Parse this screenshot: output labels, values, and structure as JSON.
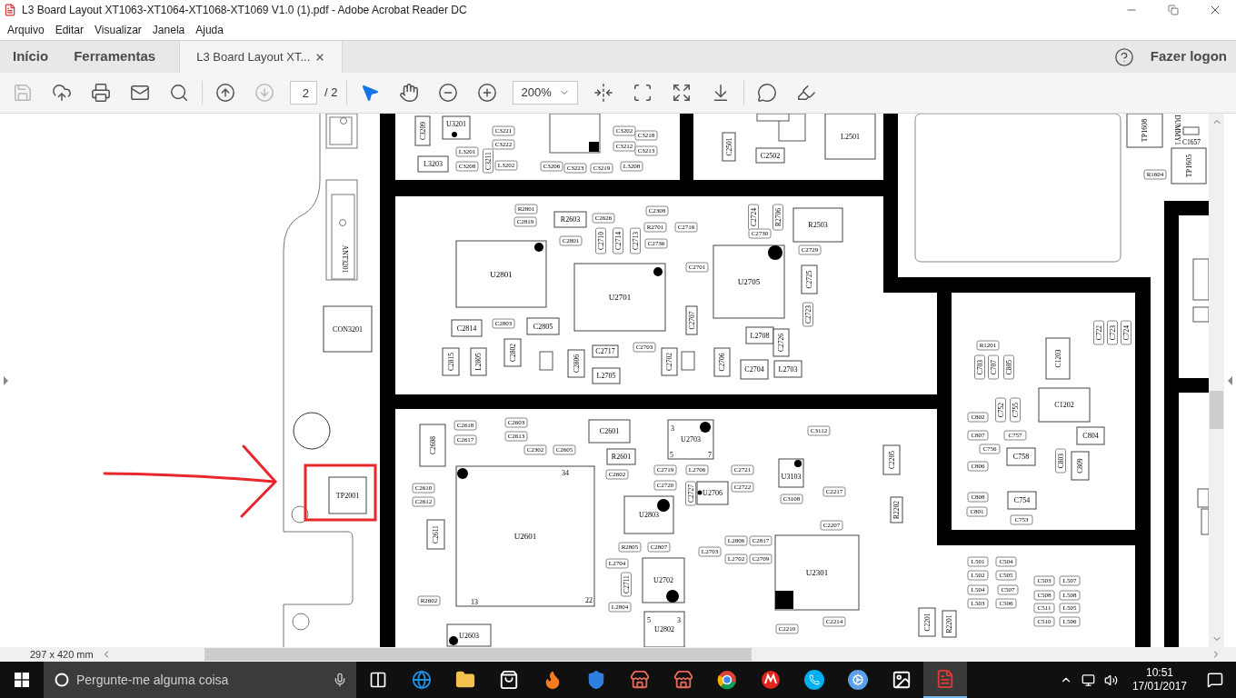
{
  "window": {
    "title": "L3 Board Layout XT1063-XT1064-XT1068-XT1069 V1.0 (1).pdf - Adobe Acrobat Reader DC"
  },
  "menu": [
    "Arquivo",
    "Editar",
    "Visualizar",
    "Janela",
    "Ajuda"
  ],
  "nav_tabs": [
    {
      "label": "Início",
      "selected": false
    },
    {
      "label": "Ferramentas",
      "selected": false
    }
  ],
  "doc_tab": {
    "label": "L3 Board Layout XT...",
    "selected": true
  },
  "account": {
    "label": "Fazer logon"
  },
  "toolbar": {
    "groups": [
      [
        {
          "kind": "save",
          "disabled": true
        },
        {
          "kind": "upload",
          "disabled": false
        },
        {
          "kind": "print",
          "disabled": false
        },
        {
          "kind": "mail",
          "disabled": false
        },
        {
          "kind": "search",
          "disabled": false
        }
      ],
      [
        {
          "kind": "prev",
          "disabled": false
        },
        {
          "kind": "next",
          "disabled": true
        },
        {
          "kind": "page_field",
          "value": "2",
          "total": "/ 2"
        }
      ],
      [
        {
          "kind": "select",
          "selected": true
        },
        {
          "kind": "hand",
          "selected": false
        },
        {
          "kind": "zoom_out",
          "disabled": false
        },
        {
          "kind": "zoom_in",
          "disabled": false
        },
        {
          "kind": "zoom_field",
          "value": "200%"
        },
        {
          "kind": "fit_width",
          "disabled": false
        },
        {
          "kind": "fit_page",
          "disabled": false
        },
        {
          "kind": "fullscreen",
          "disabled": false
        },
        {
          "kind": "read_mode",
          "disabled": false
        }
      ],
      [
        {
          "kind": "comment",
          "disabled": false
        },
        {
          "kind": "highlight",
          "disabled": false
        }
      ]
    ]
  },
  "document": {
    "parts": [
      {
        "label": "C3209",
        "kind": "vbox"
      },
      {
        "label": "U3201",
        "kind": "box"
      },
      {
        "label": "L3203",
        "kind": "box"
      },
      {
        "label": "L3201",
        "kind": "pill"
      },
      {
        "label": "C3221",
        "kind": "pill"
      },
      {
        "label": "C3222",
        "kind": "pill"
      },
      {
        "label": "C3208",
        "kind": "pill"
      },
      {
        "label": "C3211",
        "kind": "vpill"
      },
      {
        "label": "L3202",
        "kind": "pill"
      },
      {
        "label": "C3202",
        "kind": "pill"
      },
      {
        "label": "C3218",
        "kind": "pill"
      },
      {
        "label": "C3212",
        "kind": "pill"
      },
      {
        "label": "C3213",
        "kind": "pill"
      },
      {
        "label": "C3206",
        "kind": "pill"
      },
      {
        "label": "C3223",
        "kind": "pill"
      },
      {
        "label": "C3219",
        "kind": "pill"
      },
      {
        "label": "L3208",
        "kind": "pill"
      },
      {
        "label": "C2501",
        "kind": "vbox"
      },
      {
        "label": "C2502",
        "kind": "box"
      },
      {
        "label": "L2501",
        "kind": "box"
      },
      {
        "label": "ANT3201",
        "kind": "vtext"
      },
      {
        "label": "CON3201",
        "kind": "box"
      },
      {
        "label": "TP2001",
        "kind": "box"
      },
      {
        "label": "R2801",
        "kind": "pill"
      },
      {
        "label": "C2819",
        "kind": "pill"
      },
      {
        "label": "R2603",
        "kind": "box"
      },
      {
        "label": "C2626",
        "kind": "pill"
      },
      {
        "label": "C2308",
        "kind": "pill"
      },
      {
        "label": "R2701",
        "kind": "pill"
      },
      {
        "label": "C2716",
        "kind": "pill"
      },
      {
        "label": "C2801",
        "kind": "pill"
      },
      {
        "label": "C2710",
        "kind": "vpill"
      },
      {
        "label": "C2714",
        "kind": "vpill"
      },
      {
        "label": "C2713",
        "kind": "vpill"
      },
      {
        "label": "C2736",
        "kind": "pill"
      },
      {
        "label": "C2724",
        "kind": "vpill"
      },
      {
        "label": "R2706",
        "kind": "vpill"
      },
      {
        "label": "C2730",
        "kind": "pill"
      },
      {
        "label": "R2503",
        "kind": "box"
      },
      {
        "label": "C2729",
        "kind": "pill"
      },
      {
        "label": "U2801",
        "kind": "box"
      },
      {
        "label": "U2701",
        "kind": "box"
      },
      {
        "label": "U2705",
        "kind": "box"
      },
      {
        "label": "C2701",
        "kind": "pill"
      },
      {
        "label": "C2707",
        "kind": "vbox"
      },
      {
        "label": "C2725",
        "kind": "vbox"
      },
      {
        "label": "C2723",
        "kind": "vpill"
      },
      {
        "label": "C2814",
        "kind": "box"
      },
      {
        "label": "C2803",
        "kind": "pill"
      },
      {
        "label": "C2805",
        "kind": "box"
      },
      {
        "label": "L2708",
        "kind": "box"
      },
      {
        "label": "C2726",
        "kind": "vbox"
      },
      {
        "label": "C2815",
        "kind": "vbox"
      },
      {
        "label": "L2805",
        "kind": "vbox"
      },
      {
        "label": "C2802",
        "kind": "vbox"
      },
      {
        "label": "C2806",
        "kind": "vbox"
      },
      {
        "label": "C2717",
        "kind": "box"
      },
      {
        "label": "C2703",
        "kind": "pill"
      },
      {
        "label": "C2702",
        "kind": "vbox"
      },
      {
        "label": "C2706",
        "kind": "vbox"
      },
      {
        "label": "C2704",
        "kind": "box"
      },
      {
        "label": "L2705",
        "kind": "box"
      },
      {
        "label": "L2703",
        "kind": "box"
      },
      {
        "label": "C2608",
        "kind": "vbox"
      },
      {
        "label": "C2618",
        "kind": "pill"
      },
      {
        "label": "C2617",
        "kind": "pill"
      },
      {
        "label": "C2603",
        "kind": "pill"
      },
      {
        "label": "C2613",
        "kind": "pill"
      },
      {
        "label": "C2302",
        "kind": "pill"
      },
      {
        "label": "C2605",
        "kind": "pill"
      },
      {
        "label": "C2601",
        "kind": "box"
      },
      {
        "label": "R2601",
        "kind": "box"
      },
      {
        "label": "C2602",
        "kind": "pill"
      },
      {
        "label": "U2703",
        "kind": "box"
      },
      {
        "label": "3",
        "kind": "pin"
      },
      {
        "label": "5",
        "kind": "pin"
      },
      {
        "label": "7",
        "kind": "pin"
      },
      {
        "label": "C2610",
        "kind": "pill"
      },
      {
        "label": "C2612",
        "kind": "pill"
      },
      {
        "label": "C2611",
        "kind": "vbox"
      },
      {
        "label": "U2601",
        "kind": "box"
      },
      {
        "label": "34",
        "kind": "pin"
      },
      {
        "label": "R2602",
        "kind": "pill"
      },
      {
        "label": "13",
        "kind": "pin"
      },
      {
        "label": "22",
        "kind": "pin"
      },
      {
        "label": "C2719",
        "kind": "pill"
      },
      {
        "label": "L2706",
        "kind": "pill"
      },
      {
        "label": "C2720",
        "kind": "pill"
      },
      {
        "label": "C2727",
        "kind": "vpill"
      },
      {
        "label": "U2706",
        "kind": "box"
      },
      {
        "label": "C2721",
        "kind": "pill"
      },
      {
        "label": "C2722",
        "kind": "pill"
      },
      {
        "label": "U2803",
        "kind": "box"
      },
      {
        "label": "R2805",
        "kind": "pill"
      },
      {
        "label": "C2807",
        "kind": "pill"
      },
      {
        "label": "L2704",
        "kind": "pill"
      },
      {
        "label": "C2711",
        "kind": "vpill"
      },
      {
        "label": "U2702",
        "kind": "box"
      },
      {
        "label": "L2804",
        "kind": "pill"
      },
      {
        "label": "U3103",
        "kind": "box"
      },
      {
        "label": "C3112",
        "kind": "pill"
      },
      {
        "label": "C2217",
        "kind": "pill"
      },
      {
        "label": "C3108",
        "kind": "pill"
      },
      {
        "label": "C2207",
        "kind": "pill"
      },
      {
        "label": "U2301",
        "kind": "box"
      },
      {
        "label": "C2205",
        "kind": "vbox"
      },
      {
        "label": "R2202",
        "kind": "vbox"
      },
      {
        "label": "L2806",
        "kind": "pill"
      },
      {
        "label": "C2817",
        "kind": "pill"
      },
      {
        "label": "L2703",
        "kind": "pill"
      },
      {
        "label": "L2702",
        "kind": "pill"
      },
      {
        "label": "C2709",
        "kind": "pill"
      },
      {
        "label": "U2603",
        "kind": "box"
      },
      {
        "label": "U2802",
        "kind": "box"
      },
      {
        "label": "5",
        "kind": "pin"
      },
      {
        "label": "3",
        "kind": "pin"
      },
      {
        "label": "C2201",
        "kind": "vbox"
      },
      {
        "label": "R2201",
        "kind": "vbox"
      },
      {
        "label": "C2210",
        "kind": "pill"
      },
      {
        "label": "C2214",
        "kind": "pill"
      },
      {
        "label": "R1201",
        "kind": "pill"
      },
      {
        "label": "C703",
        "kind": "vpill"
      },
      {
        "label": "C707",
        "kind": "vpill"
      },
      {
        "label": "C805",
        "kind": "vpill"
      },
      {
        "label": "C1203",
        "kind": "vbox"
      },
      {
        "label": "C722",
        "kind": "vpill"
      },
      {
        "label": "C723",
        "kind": "vpill"
      },
      {
        "label": "C724",
        "kind": "vpill"
      },
      {
        "label": "C752",
        "kind": "vpill"
      },
      {
        "label": "C755",
        "kind": "vpill"
      },
      {
        "label": "C1202",
        "kind": "box"
      },
      {
        "label": "C802",
        "kind": "pill"
      },
      {
        "label": "C807",
        "kind": "pill"
      },
      {
        "label": "C757",
        "kind": "pill"
      },
      {
        "label": "C804",
        "kind": "box"
      },
      {
        "label": "C756",
        "kind": "pill"
      },
      {
        "label": "C758",
        "kind": "box"
      },
      {
        "label": "C803",
        "kind": "vpill"
      },
      {
        "label": "C809",
        "kind": "vbox"
      },
      {
        "label": "C806",
        "kind": "pill"
      },
      {
        "label": "C808",
        "kind": "pill"
      },
      {
        "label": "C754",
        "kind": "box"
      },
      {
        "label": "C801",
        "kind": "pill"
      },
      {
        "label": "C753",
        "kind": "pill"
      },
      {
        "label": "L501",
        "kind": "pill"
      },
      {
        "label": "C504",
        "kind": "pill"
      },
      {
        "label": "L502",
        "kind": "pill"
      },
      {
        "label": "C505",
        "kind": "pill"
      },
      {
        "label": "L504",
        "kind": "pill"
      },
      {
        "label": "C507",
        "kind": "pill"
      },
      {
        "label": "L503",
        "kind": "pill"
      },
      {
        "label": "C506",
        "kind": "pill"
      },
      {
        "label": "C503",
        "kind": "pill"
      },
      {
        "label": "L507",
        "kind": "pill"
      },
      {
        "label": "C508",
        "kind": "pill"
      },
      {
        "label": "L508",
        "kind": "pill"
      },
      {
        "label": "C511",
        "kind": "pill"
      },
      {
        "label": "L505",
        "kind": "pill"
      },
      {
        "label": "C510",
        "kind": "pill"
      },
      {
        "label": "L506",
        "kind": "pill"
      },
      {
        "label": "TP1608",
        "kind": "vbox"
      },
      {
        "label": "DUMMY1",
        "kind": "vtext"
      },
      {
        "label": "C1657",
        "kind": "text"
      },
      {
        "label": "TP1605",
        "kind": "vbox"
      },
      {
        "label": "R1604",
        "kind": "pill"
      }
    ]
  },
  "status": {
    "page_size": "297 x 420 mm"
  },
  "taskbar": {
    "search_placeholder": "Pergunte-me alguma coisa",
    "apps": [
      {
        "kind": "task_view",
        "active": false
      },
      {
        "kind": "browser",
        "active": false
      },
      {
        "kind": "folder",
        "active": false
      },
      {
        "kind": "store",
        "active": false
      },
      {
        "kind": "flame",
        "active": false
      },
      {
        "kind": "shield",
        "active": false
      },
      {
        "kind": "shop",
        "active": false
      },
      {
        "kind": "shop",
        "active": false
      },
      {
        "kind": "segmented",
        "active": false
      },
      {
        "kind": "wing",
        "active": false
      },
      {
        "kind": "phone",
        "active": false
      },
      {
        "kind": "gear",
        "active": false
      },
      {
        "kind": "photo",
        "active": false
      },
      {
        "kind": "pdf",
        "active": true
      }
    ],
    "time": "10:51",
    "date": "17/01/2017"
  }
}
